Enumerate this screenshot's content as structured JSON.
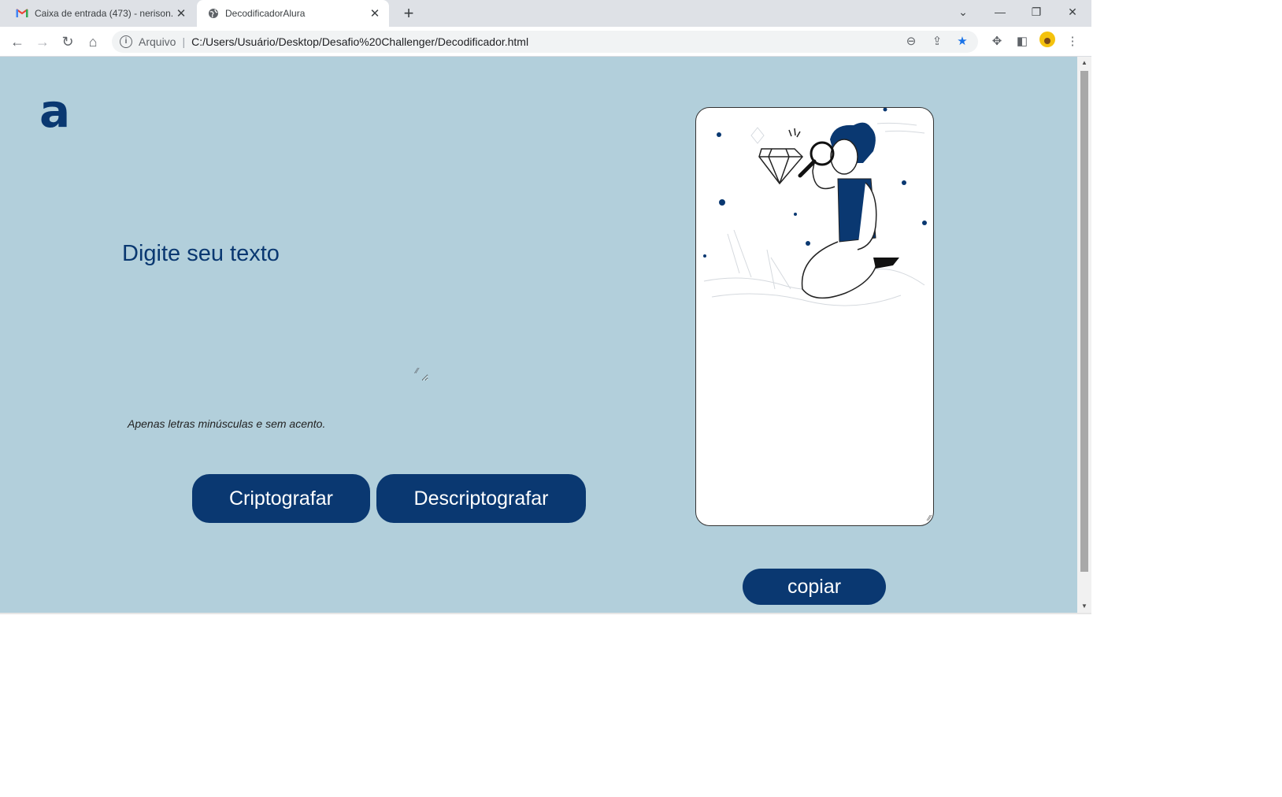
{
  "browser": {
    "tabs": [
      {
        "title": "Caixa de entrada (473) - nerison.",
        "active": false,
        "icon": "gmail-icon"
      },
      {
        "title": "DecodificadorAlura",
        "active": true,
        "icon": "globe-icon"
      }
    ],
    "address": {
      "prefix": "Arquivo",
      "url": "C:/Users/Usuário/Desktop/Desafio%20Challenger/Decodificador.html"
    }
  },
  "page": {
    "logo": "a",
    "heading": "Digite seu texto",
    "hint": "Apenas letras minúsculas e sem acento.",
    "buttons": {
      "encrypt": "Criptografar",
      "decrypt": "Descriptografar",
      "copy": "copiar"
    }
  },
  "colors": {
    "page_bg": "#b2cfdb",
    "primary": "#0a3871",
    "card_bg": "#ffffff"
  }
}
